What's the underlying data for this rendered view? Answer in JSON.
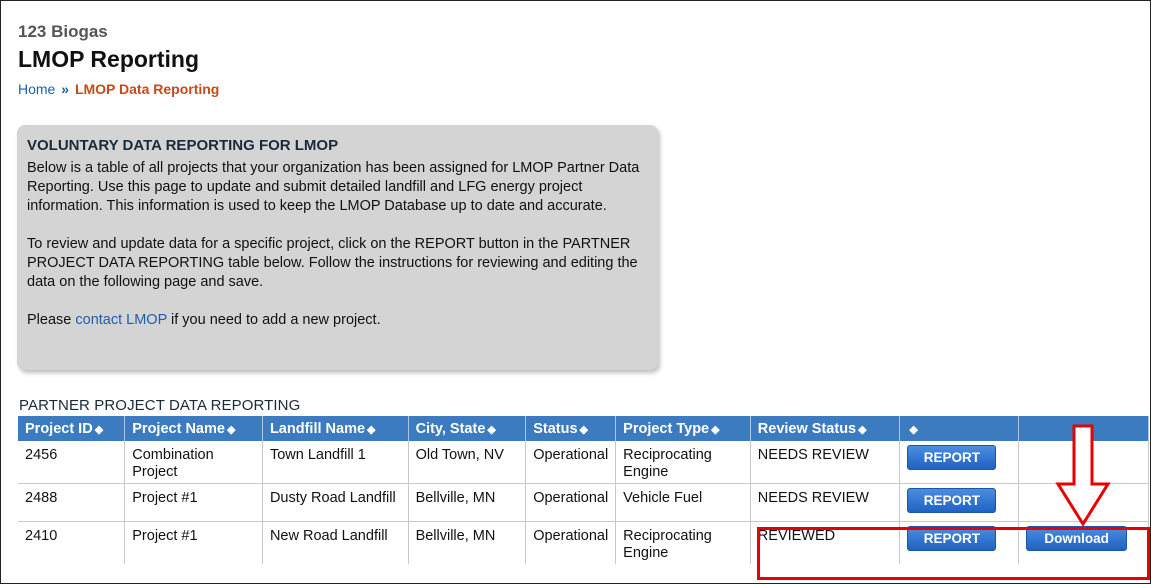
{
  "header": {
    "org": "123 Biogas",
    "title": "LMOP Reporting",
    "breadcrumb": {
      "home": "Home",
      "sep": "»",
      "current": "LMOP Data Reporting"
    }
  },
  "panel": {
    "heading": "VOLUNTARY DATA REPORTING FOR LMOP",
    "para1": "Below is a table of all projects that your organization has been assigned for LMOP Partner Data Reporting. Use this page to update and submit detailed landfill and LFG energy project information. This information is used to keep the LMOP Database up to date and accurate.",
    "para2": "To review and update data for a specific project, click on the REPORT button in the PARTNER PROJECT DATA REPORTING table below. Follow the instructions for reviewing and editing the data on the following page and save.",
    "para3_pre": "Please ",
    "para3_link": "contact LMOP",
    "para3_post": " if you need to add a new project."
  },
  "table": {
    "title": "PARTNER PROJECT DATA REPORTING",
    "sort_glyph": "◆",
    "headers": [
      "Project ID",
      "Project Name",
      "Landfill Name",
      "City, State",
      "Status",
      "Project Type",
      "Review Status",
      "",
      ""
    ],
    "rows": [
      {
        "id": "2456",
        "name": "Combination Project",
        "landfill": "Town Landfill 1",
        "city": "Old Town, NV",
        "status": "Operational",
        "type": "Reciprocating Engine",
        "review": "NEEDS REVIEW",
        "report": "REPORT",
        "download": ""
      },
      {
        "id": "2488",
        "name": "Project #1",
        "landfill": "Dusty Road Landfill",
        "city": "Bellville, MN",
        "status": "Operational",
        "type": "Vehicle Fuel",
        "review": "NEEDS REVIEW",
        "report": "REPORT",
        "download": ""
      },
      {
        "id": "2410",
        "name": "Project #1",
        "landfill": "New Road Landfill",
        "city": "Bellville, MN",
        "status": "Operational",
        "type": "Reciprocating Engine",
        "review": "REVIEWED",
        "report": "REPORT",
        "download": "Download"
      }
    ]
  },
  "annotation": {
    "color": "#e80000",
    "icon": "down-arrow-icon"
  },
  "colors": {
    "header_bg": "#3c7bbf",
    "button_bg": "#1f62c2",
    "link": "#1f5fa8",
    "crumb_current": "#c54a1a",
    "panel_bg": "#d4d4d4"
  }
}
